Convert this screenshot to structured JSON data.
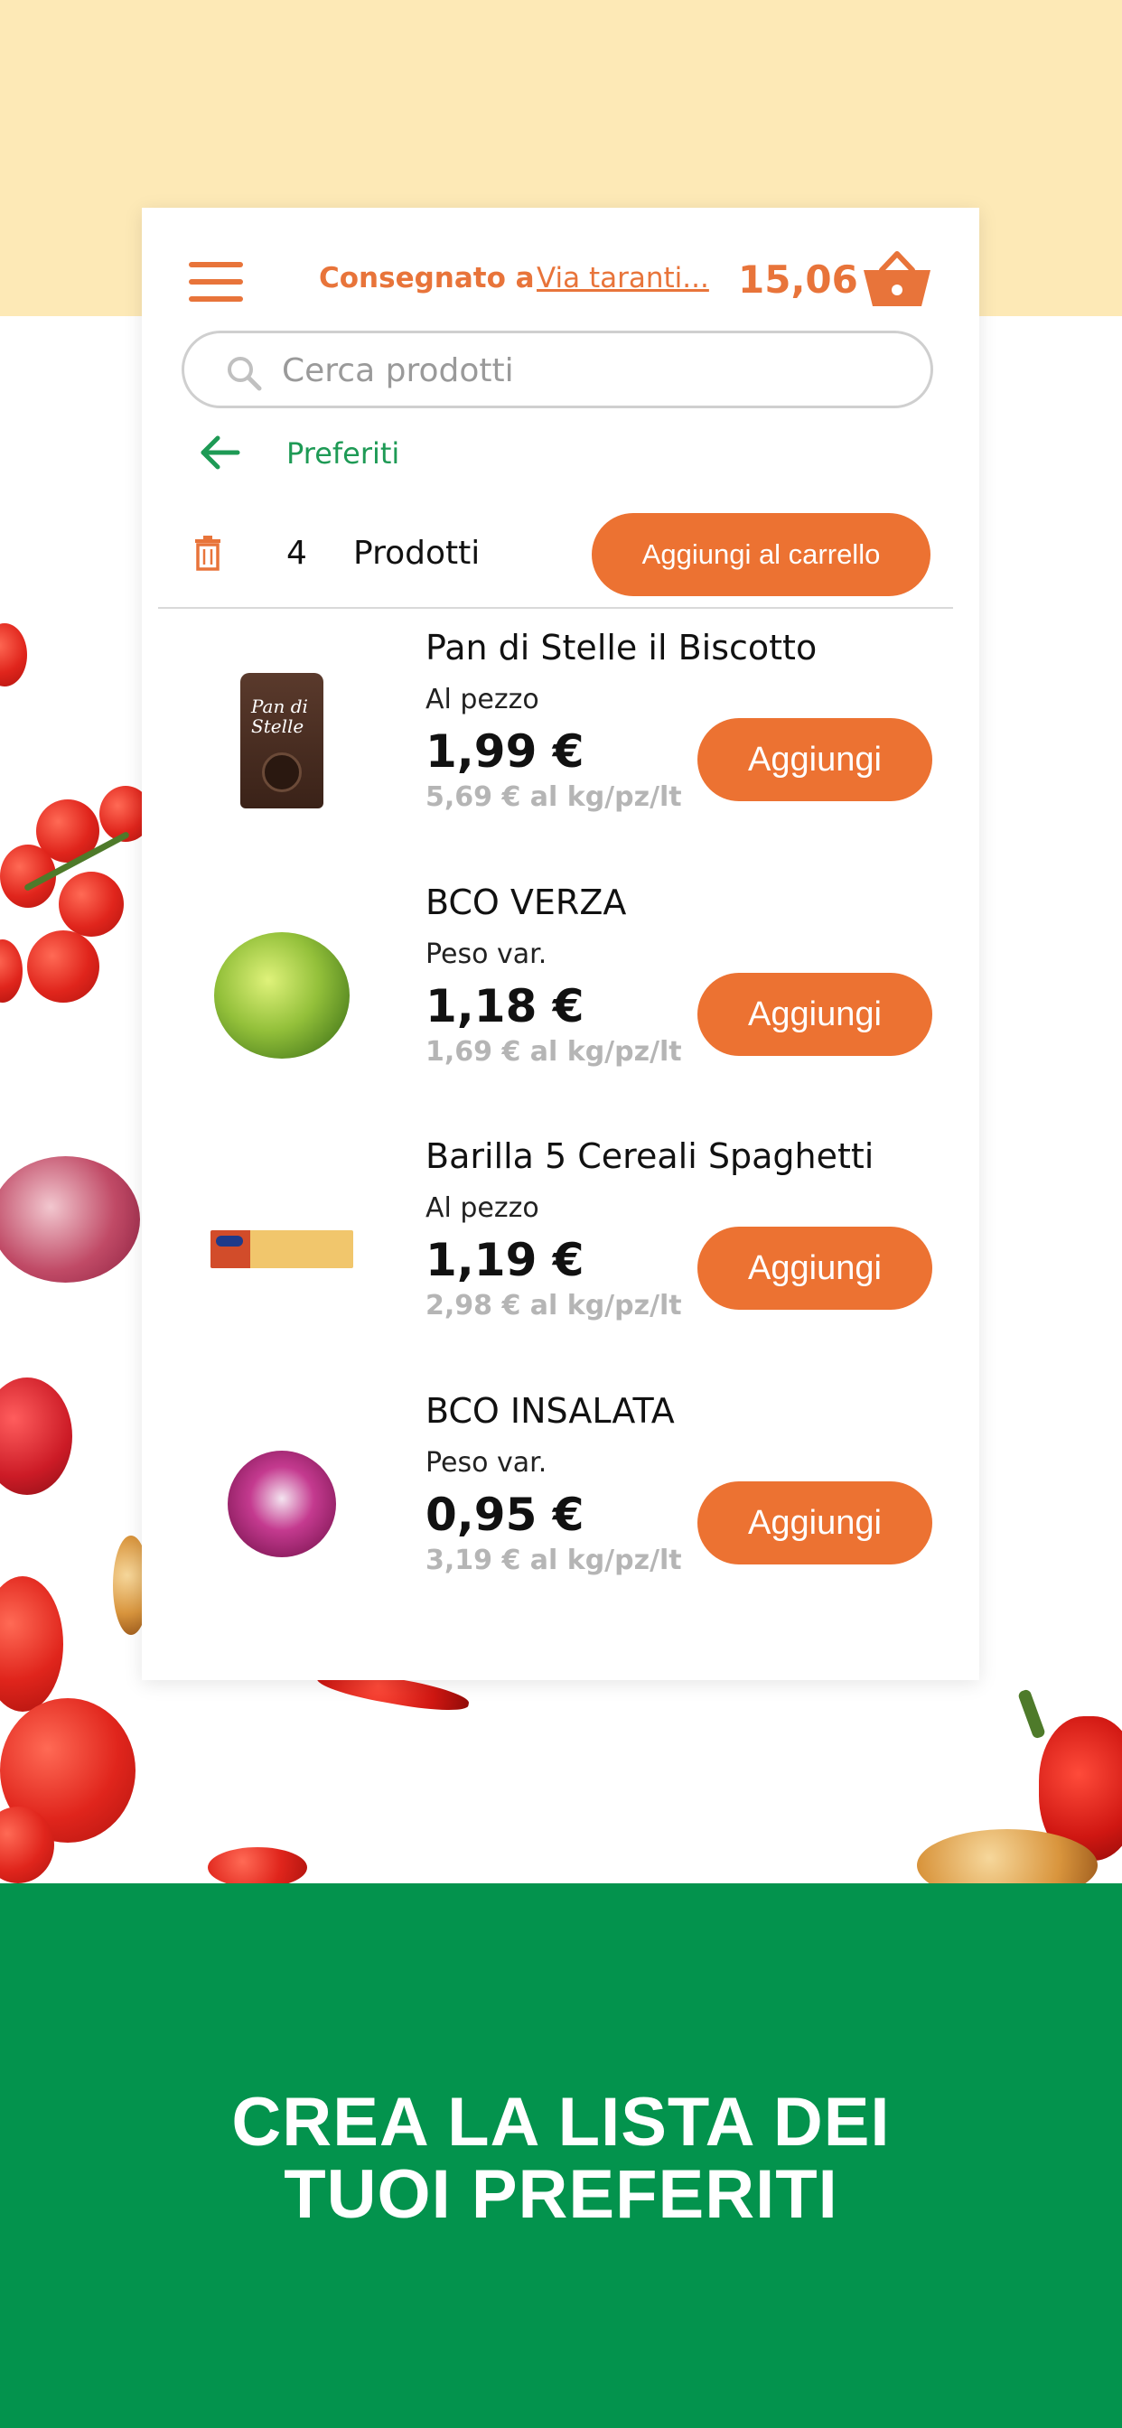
{
  "header": {
    "delivery_label": "Consegnato a",
    "delivery_address": "Via taranti...",
    "cart_total": "15,06"
  },
  "search": {
    "placeholder": "Cerca prodotti"
  },
  "breadcrumb": {
    "label": "Preferiti"
  },
  "favorites": {
    "count": "4",
    "count_label": "Prodotti",
    "add_all_label": "Aggiungi al carrello"
  },
  "products": [
    {
      "name": "Pan di Stelle il Biscotto",
      "unit": "Al pezzo",
      "price": "1,99 €",
      "per_unit": "5,69 € al kg/pz/lt",
      "button": "Aggiungi"
    },
    {
      "name": "BCO VERZA",
      "unit": "Peso var.",
      "price": "1,18 €",
      "per_unit": "1,69 € al kg/pz/lt",
      "button": "Aggiungi"
    },
    {
      "name": "Barilla 5 Cereali Spaghetti",
      "unit": "Al pezzo",
      "price": "1,19 €",
      "per_unit": "2,98 € al kg/pz/lt",
      "button": "Aggiungi"
    },
    {
      "name": "BCO INSALATA",
      "unit": "Peso var.",
      "price": "0,95 €",
      "per_unit": "3,19 € al kg/pz/lt",
      "button": "Aggiungi"
    }
  ],
  "promo": {
    "line1": "CREA LA LISTA DEI",
    "line2": "TUOI PREFERITI"
  },
  "colors": {
    "accent": "#ec7232",
    "green": "#03934d",
    "top_band": "#fde9b6"
  },
  "icons": [
    "menu-icon",
    "basket-icon",
    "search-icon",
    "back-arrow-icon",
    "trash-icon"
  ],
  "packaging_text": {
    "pan_di_stelle": "Pan di Stelle"
  }
}
